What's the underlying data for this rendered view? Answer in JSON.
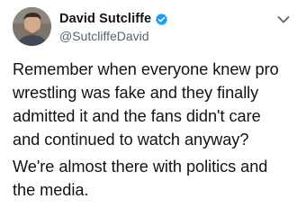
{
  "tweet": {
    "author": {
      "display_name": "David Sutcliffe",
      "handle": "@SutcliffeDavid",
      "verified": true,
      "avatar_icon": "profile-photo"
    },
    "body": {
      "paragraph_1": [
        "Remember when everyone knew pro",
        "wrestling was fake and they finally",
        "admitted it and the fans didn't care",
        "and continued to watch anyway?"
      ],
      "paragraph_2": [
        "We're almost there with politics and",
        "the media."
      ]
    },
    "menu_icon": "chevron-down-icon"
  },
  "colors": {
    "text": "#0f1419",
    "secondary_text": "#536471",
    "verified_badge": "#1d9bf0",
    "background": "#ffffff"
  }
}
